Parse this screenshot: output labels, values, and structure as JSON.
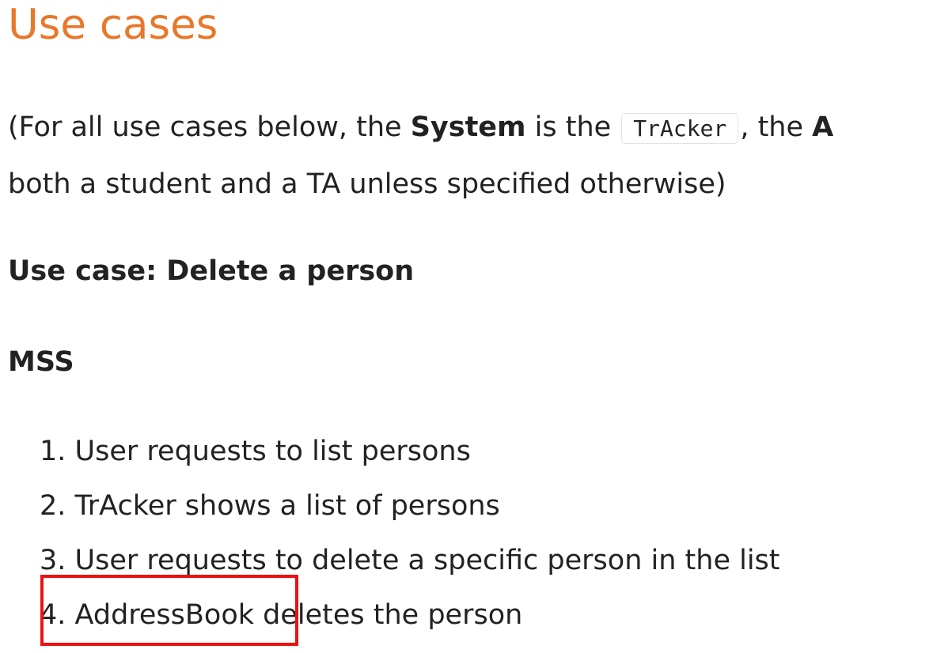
{
  "section": {
    "title": "Use cases"
  },
  "intro": {
    "part1": "(For all use cases below, the ",
    "system_bold": "System",
    "part2": " is the ",
    "code": "TrAcker",
    "part3": ", the ",
    "actor_bold_partial": "A",
    "line2": "both a student and a TA unless specified otherwise)"
  },
  "use_case": {
    "heading": "Use case: Delete a person"
  },
  "mss": {
    "heading": "MSS",
    "steps": [
      "1. User requests to list persons",
      "2. TrAcker shows a list of persons",
      "3. User requests to delete a specific person in the list",
      "4. AddressBook deletes the person"
    ]
  },
  "annotation": {
    "color": "#ee1111",
    "target": "4. AddressBook"
  }
}
